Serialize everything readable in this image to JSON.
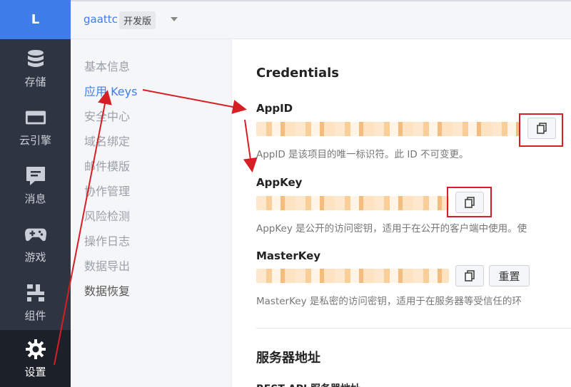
{
  "rail": {
    "logo": "L",
    "items": [
      {
        "label": "存储",
        "icon": "database-icon"
      },
      {
        "label": "云引擎",
        "icon": "engine-icon"
      },
      {
        "label": "消息",
        "icon": "message-icon"
      },
      {
        "label": "游戏",
        "icon": "gamepad-icon"
      },
      {
        "label": "组件",
        "icon": "components-icon"
      },
      {
        "label": "设置",
        "icon": "gear-icon",
        "active": true
      }
    ]
  },
  "header": {
    "app_name": "gaattc",
    "plan_badge": "开发版"
  },
  "subnav": {
    "items": [
      "基本信息",
      "应用 Keys",
      "安全中心",
      "域名绑定",
      "邮件模版",
      "协作管理",
      "风险检测",
      "操作日志",
      "数据导出",
      "数据恢复"
    ],
    "active": "应用 Keys"
  },
  "main": {
    "credentials_title": "Credentials",
    "appid": {
      "label": "AppID",
      "description": "AppID 是该项目的唯一标识符。此 ID 不可变更。"
    },
    "appkey": {
      "label": "AppKey",
      "description": "AppKey 是公开的访问密钥，适用于在公开的客户端中使用。使"
    },
    "masterkey": {
      "label": "MasterKey",
      "description": "MasterKey 是私密的访问密钥，适用于在服务器等受信任的环",
      "reset_label": "重置"
    },
    "server_title": "服务器地址",
    "next_label": "REST API 服务器地址"
  },
  "colors": {
    "accent": "#3f7de8",
    "rail_bg": "#2f3441",
    "annotation": "#d81e25"
  }
}
